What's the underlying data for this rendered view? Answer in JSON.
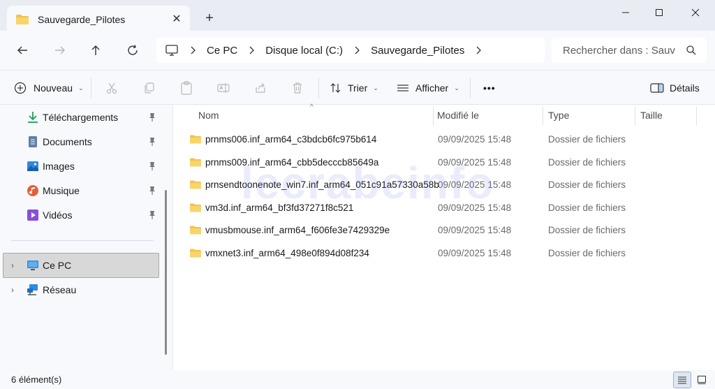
{
  "window": {
    "tab_title": "Sauvegarde_Pilotes",
    "new_tab_symbol": "+",
    "close_tab_symbol": "✕"
  },
  "address": {
    "crumbs": [
      "Ce PC",
      "Disque local (C:)",
      "Sauvegarde_Pilotes"
    ],
    "search_placeholder": "Rechercher dans : Sauv"
  },
  "toolbar": {
    "new_label": "Nouveau",
    "sort_label": "Trier",
    "view_label": "Afficher",
    "more_label": "•••",
    "details_label": "Détails"
  },
  "sidebar": {
    "quick_access": [
      {
        "label": "Téléchargements",
        "icon": "download-icon"
      },
      {
        "label": "Documents",
        "icon": "document-icon"
      },
      {
        "label": "Images",
        "icon": "image-icon"
      },
      {
        "label": "Musique",
        "icon": "music-icon"
      },
      {
        "label": "Vidéos",
        "icon": "video-icon"
      }
    ],
    "this_pc": "Ce PC",
    "network": "Réseau"
  },
  "columns": {
    "name": "Nom",
    "modified": "Modifié le",
    "type": "Type",
    "size": "Taille"
  },
  "files": [
    {
      "name": "prnms006.inf_arm64_c3bdcb6fc975b614",
      "modified": "09/09/2025 15:48",
      "type": "Dossier de fichiers"
    },
    {
      "name": "prnms009.inf_arm64_cbb5decccb85649a",
      "modified": "09/09/2025 15:48",
      "type": "Dossier de fichiers"
    },
    {
      "name": "prnsendtoonenote_win7.inf_arm64_051c91a57330a58b",
      "modified": "09/09/2025 15:48",
      "type": "Dossier de fichiers"
    },
    {
      "name": "vm3d.inf_arm64_bf3fd37271f8c521",
      "modified": "09/09/2025 15:48",
      "type": "Dossier de fichiers"
    },
    {
      "name": "vmusbmouse.inf_arm64_f606fe3e7429329e",
      "modified": "09/09/2025 15:48",
      "type": "Dossier de fichiers"
    },
    {
      "name": "vmxnet3.inf_arm64_498e0f894d08f234",
      "modified": "09/09/2025 15:48",
      "type": "Dossier de fichiers"
    }
  ],
  "status": {
    "count_text": "6 élément(s)"
  },
  "watermark": "lecrabeinfo",
  "colors": {
    "folder": "#f2c14e",
    "accent": "#0067c0",
    "selected_bg": "#d8d8d8"
  }
}
